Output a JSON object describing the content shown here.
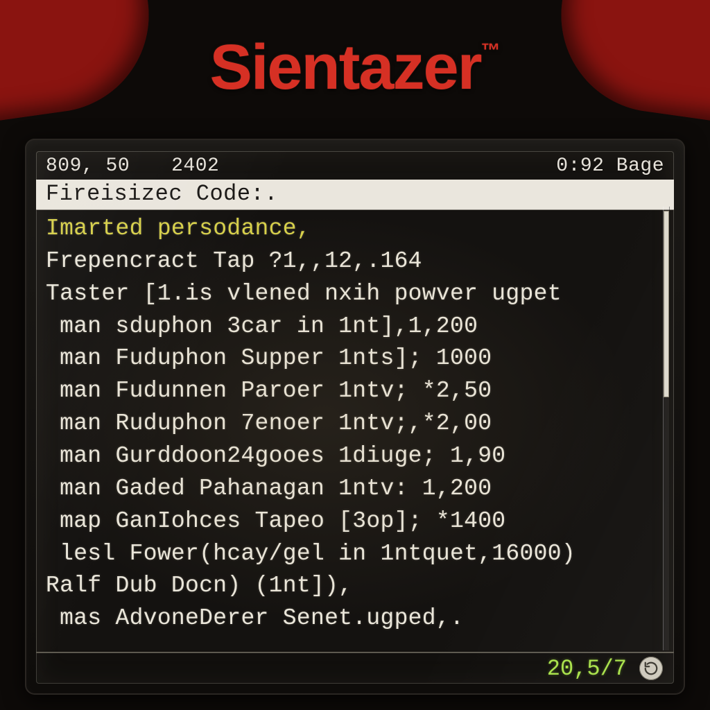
{
  "brand": {
    "name": "Sientazer",
    "tm": "™"
  },
  "titlebar": {
    "left": "809, 50",
    "center": "2402",
    "right": "0:92 Bage"
  },
  "highlight": "Fireisizec Code:.",
  "lines": [
    {
      "text": "Imarted persodance,",
      "accent": true
    },
    {
      "text": "Frepencract Tap ?1,,12,.164",
      "accent": false
    },
    {
      "text": "Taster [1.is vlened nxih powver ugpet",
      "accent": false
    },
    {
      "text": " man sduphon 3car in 1nt],1,200",
      "accent": false
    },
    {
      "text": " man Fuduphon Supper 1nts]; 1000",
      "accent": false
    },
    {
      "text": " man Fudunnen Paroer 1ntv; *2,50",
      "accent": false
    },
    {
      "text": " man Ruduphon 7enoer 1ntv;,*2,00",
      "accent": false
    },
    {
      "text": " man Gurddoon24gooes 1diuge; 1,90",
      "accent": false
    },
    {
      "text": " man Gaded Pahanagan 1ntv: 1,200",
      "accent": false
    },
    {
      "text": " map GanIohces Tapeo [3op]; *1400",
      "accent": false
    },
    {
      "text": " lesl Fower(hcay/gel in 1ntquet,16000)",
      "accent": false
    },
    {
      "text": "Ralf Dub Docn) (1nt]),",
      "accent": false
    },
    {
      "text": " mas AdvoneDerer Senet.ugped,.",
      "accent": false
    }
  ],
  "scrollbar": {
    "thumb_top_pct": 1,
    "thumb_height_pct": 42
  },
  "status": {
    "page": "20,5/7",
    "icon": "refresh-icon"
  },
  "colors": {
    "brand_red": "#d63024",
    "accent_yellow": "#d7d04a",
    "status_green": "#a9e24a",
    "text": "#eae6da",
    "highlight_bg": "#eae6dd"
  }
}
